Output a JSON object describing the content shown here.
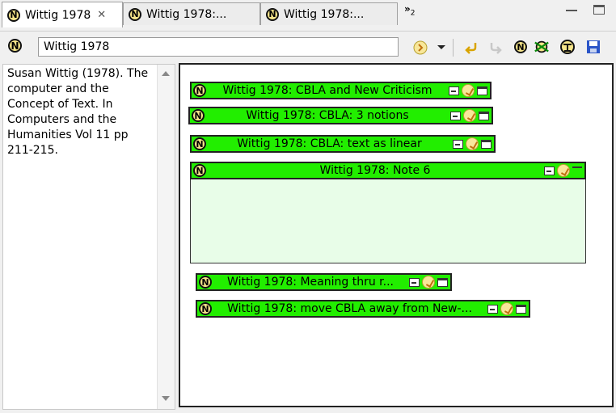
{
  "tabs": [
    {
      "label": "Wittig 1978",
      "close": "✕",
      "active": true
    },
    {
      "label": "Wittig 1978:...",
      "active": false
    },
    {
      "label": "Wittig 1978:...",
      "active": false
    }
  ],
  "tab_overflow": {
    "chevron": "»",
    "count": "2"
  },
  "toolbar": {
    "note_title_value": "Wittig 1978",
    "icons": [
      "hoist-icon",
      "dropdown-icon",
      "back-icon",
      "forward-icon",
      "note-icon",
      "disconnect-icon",
      "tree-icon",
      "save-icon"
    ]
  },
  "left_panel": {
    "text": "Susan Wittig (1978). The computer and the Concept of Text. In Computers and the Humanities Vol 11 pp 211-215."
  },
  "notes": [
    {
      "title": "Wittig 1978: CBLA and New Criticism",
      "expanded": false
    },
    {
      "title": "Wittig 1978: CBLA: 3 notions",
      "expanded": false
    },
    {
      "title": "Wittig 1978: CBLA: text as linear",
      "expanded": false
    },
    {
      "title": "Wittig 1978: Note 6",
      "expanded": true
    },
    {
      "title": "Wittig 1978: Meaning thru r...",
      "expanded": false
    },
    {
      "title": "Wittig 1978: move CBLA away from New-...",
      "expanded": false
    }
  ],
  "colors": {
    "note_bg": "#22ee00",
    "note_body_bg": "#e8fde8",
    "canvas_border": "#222222"
  }
}
